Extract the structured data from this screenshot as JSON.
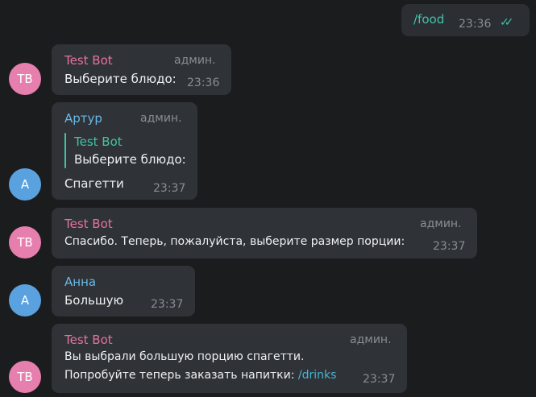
{
  "messages": [
    {
      "text": "/food",
      "time": "23:36",
      "checks": "✓✓"
    },
    {
      "avatar": "TB",
      "sender": "Test Bot",
      "badge": "админ.",
      "text": "Выберите блюдо:",
      "time": "23:36"
    },
    {
      "avatar": "А",
      "sender": "Артур",
      "badge": "админ.",
      "reply_sender": "Test Bot",
      "reply_text": "Выберите блюдо:",
      "text": "Спагетти",
      "time": "23:37"
    },
    {
      "avatar": "TB",
      "sender": "Test Bot",
      "badge": "админ.",
      "text": "Спасибо. Теперь, пожалуйста, выберите размер порции:",
      "time": "23:37"
    },
    {
      "avatar": "А",
      "sender": "Анна",
      "text": "Большую",
      "time": "23:37"
    },
    {
      "avatar": "TB",
      "sender": "Test Bot",
      "badge": "админ.",
      "line1": "Вы выбрали большую порцию спагетти.",
      "line2_prefix": "Попробуйте теперь заказать напитки: ",
      "line2_link": "/drinks",
      "time": "23:37"
    }
  ],
  "colors": {
    "background": "#1b1c1e",
    "bubble": "#2f3236",
    "bot_name": "#e7729f",
    "user_name": "#6ab8e8",
    "reply_accent": "#3fc6a8",
    "link": "#45b6d6",
    "avatar_bot": "#e77fae",
    "avatar_user": "#5aa2df"
  }
}
